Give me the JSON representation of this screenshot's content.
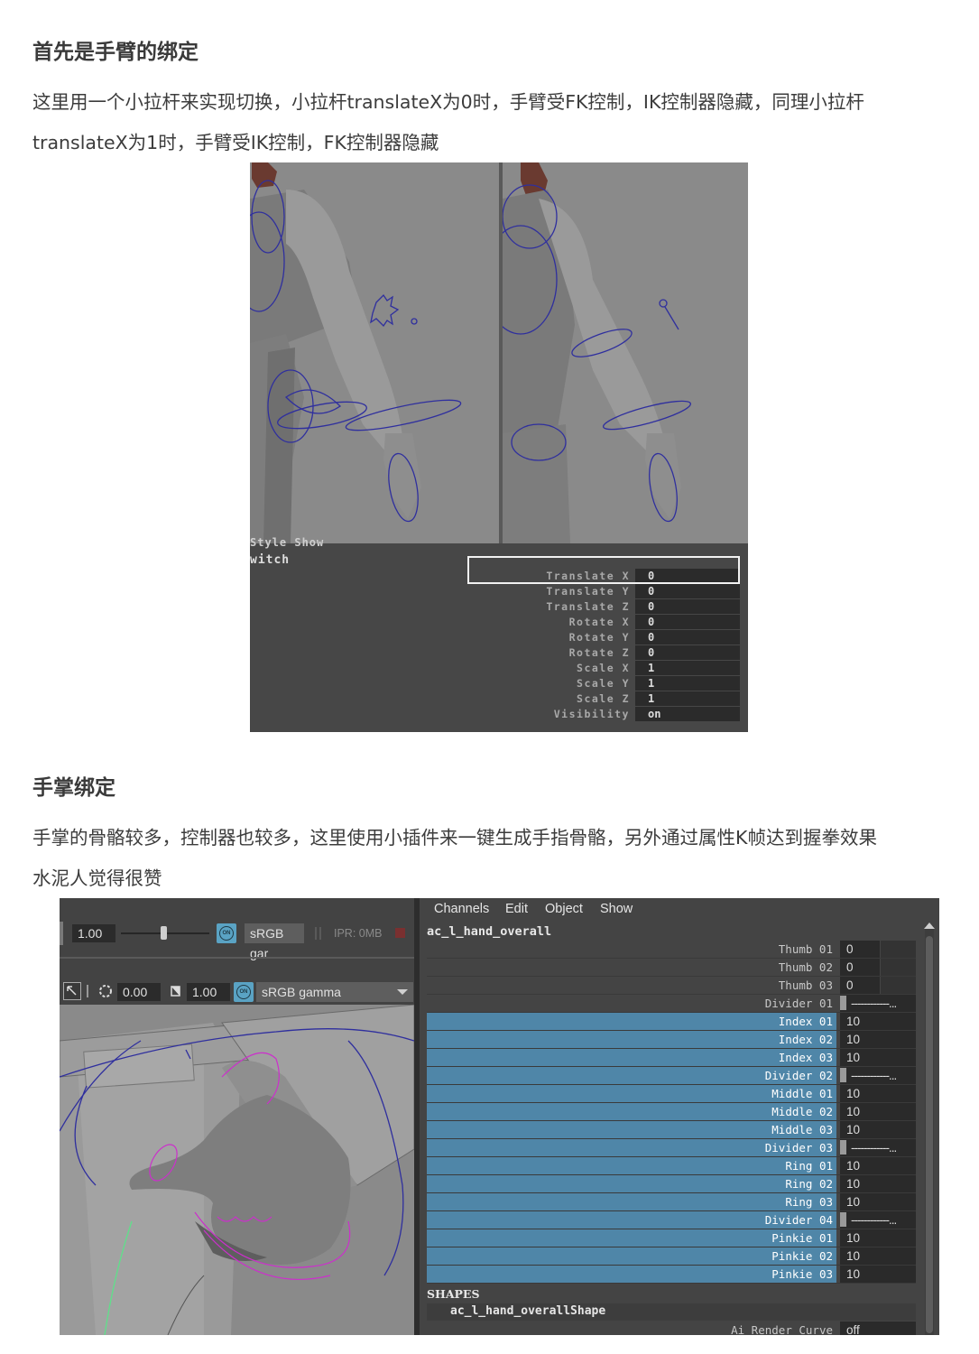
{
  "section1": {
    "heading": "首先是手臂的绑定",
    "para_line1": "这里用一个小拉杆来实现切换，小拉杆translateX为0时，手臂受FK控制，IK控制器隐藏，同理小拉杆",
    "para_line2": "translateX为1时，手臂受IK控制，FK控制器隐藏"
  },
  "figure1": {
    "header_partial": "Style   Show",
    "object_name": "witch",
    "channels": [
      {
        "label": "Translate X",
        "value": "0"
      },
      {
        "label": "Translate Y",
        "value": "0"
      },
      {
        "label": "Translate Z",
        "value": "0"
      },
      {
        "label": "Rotate X",
        "value": "0"
      },
      {
        "label": "Rotate Y",
        "value": "0"
      },
      {
        "label": "Rotate Z",
        "value": "0"
      },
      {
        "label": "Scale X",
        "value": "1"
      },
      {
        "label": "Scale Y",
        "value": "1"
      },
      {
        "label": "Scale Z",
        "value": "1"
      },
      {
        "label": "Visibility",
        "value": "on"
      }
    ]
  },
  "section2": {
    "heading": "手掌绑定",
    "para_line1": "手掌的骨骼较多，控制器也较多，这里使用小插件来一键生成手指骨骼，另外通过属性K帧达到握拳效果",
    "para_line2": "水泥人觉得很赞"
  },
  "figure2": {
    "toolbar1": {
      "value": "1.00",
      "on_label": "ON",
      "colorspace": "sRGB gar",
      "ipr": "IPR: 0MB"
    },
    "toolbar2": {
      "exposure": "0.00",
      "gamma": "1.00",
      "on_label": "ON",
      "colorspace": "sRGB gamma"
    },
    "channel_menu": [
      "Channels",
      "Edit",
      "Object",
      "Show"
    ],
    "object_name": "ac_l_hand_overall",
    "attributes": [
      {
        "label": "Thumb 01",
        "value": "0",
        "selected": false,
        "type": "short"
      },
      {
        "label": "Thumb 02",
        "value": "0",
        "selected": false,
        "type": "short"
      },
      {
        "label": "Thumb 03",
        "value": "0",
        "selected": false,
        "type": "short"
      },
      {
        "label": "Divider 01",
        "value": "------------...",
        "selected": false,
        "type": "divider"
      },
      {
        "label": "Index 01",
        "value": "10",
        "selected": true,
        "type": "num"
      },
      {
        "label": "Index 02",
        "value": "10",
        "selected": true,
        "type": "num"
      },
      {
        "label": "Index 03",
        "value": "10",
        "selected": true,
        "type": "num"
      },
      {
        "label": "Divider 02",
        "value": "------------...",
        "selected": true,
        "type": "divider"
      },
      {
        "label": "Middle 01",
        "value": "10",
        "selected": true,
        "type": "num"
      },
      {
        "label": "Middle 02",
        "value": "10",
        "selected": true,
        "type": "num"
      },
      {
        "label": "Middle 03",
        "value": "10",
        "selected": true,
        "type": "num"
      },
      {
        "label": "Divider 03",
        "value": "------------...",
        "selected": true,
        "type": "divider"
      },
      {
        "label": "Ring 01",
        "value": "10",
        "selected": true,
        "type": "num"
      },
      {
        "label": "Ring 02",
        "value": "10",
        "selected": true,
        "type": "num"
      },
      {
        "label": "Ring 03",
        "value": "10",
        "selected": true,
        "type": "num"
      },
      {
        "label": "Divider 04",
        "value": "------------...",
        "selected": true,
        "type": "divider"
      },
      {
        "label": "Pinkie 01",
        "value": "10",
        "selected": true,
        "type": "num"
      },
      {
        "label": "Pinkie 02",
        "value": "10",
        "selected": true,
        "type": "num"
      },
      {
        "label": "Pinkie 03",
        "value": "10",
        "selected": true,
        "type": "num"
      }
    ],
    "shapes_header": "SHAPES",
    "shape_name": "ac_l_hand_overallShape",
    "ai_render_curve": {
      "label": "Ai Render Curve",
      "value": "off"
    }
  },
  "colors": {
    "selected_row": "#4f86a8",
    "on_button": "#5aa3c4",
    "control_curve": "#2f2f9e",
    "finger_curve": "#cc2fcc"
  }
}
